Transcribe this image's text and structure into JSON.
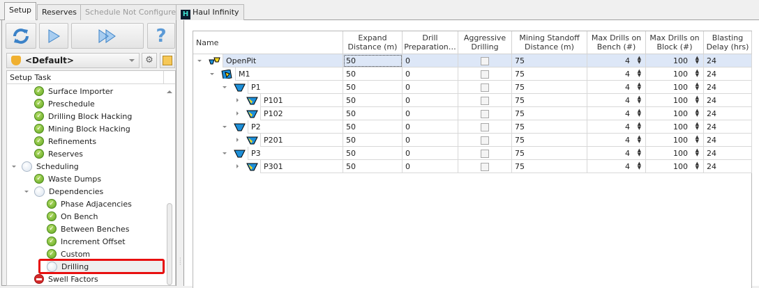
{
  "tabs": [
    {
      "label": "Setup",
      "state": "active"
    },
    {
      "label": "Reserves",
      "state": "normal"
    },
    {
      "label": "Schedule Not Configured",
      "state": "disabled"
    },
    {
      "label": "Haul Infinity",
      "state": "normal",
      "icon": "haul-infinity-icon"
    }
  ],
  "toolbar": {
    "buttons": [
      "refresh-icon",
      "play-icon",
      "fast-forward-icon",
      "help-icon"
    ],
    "help_glyph": "?"
  },
  "profile": {
    "selected": "<Default>",
    "gear_glyph": "⚙"
  },
  "setup_task": {
    "header": "Setup Task",
    "items": [
      {
        "label": "Surface Importer",
        "status": "ok",
        "level": 2
      },
      {
        "label": "Preschedule",
        "status": "ok",
        "level": 2
      },
      {
        "label": "Drilling Block Hacking",
        "status": "ok",
        "level": 2
      },
      {
        "label": "Mining Block Hacking",
        "status": "ok",
        "level": 2
      },
      {
        "label": "Refinements",
        "status": "ok",
        "level": 2
      },
      {
        "label": "Reserves",
        "status": "ok",
        "level": 2
      },
      {
        "label": "Scheduling",
        "status": "pending",
        "level": 1,
        "expanded": true
      },
      {
        "label": "Waste Dumps",
        "status": "ok",
        "level": 2
      },
      {
        "label": "Dependencies",
        "status": "pending",
        "level": 2,
        "expanded": true
      },
      {
        "label": "Phase Adjacencies",
        "status": "ok",
        "level": 3
      },
      {
        "label": "On Bench",
        "status": "ok",
        "level": 3
      },
      {
        "label": "Between Benches",
        "status": "ok",
        "level": 3
      },
      {
        "label": "Increment Offset",
        "status": "ok",
        "level": 3
      },
      {
        "label": "Custom",
        "status": "ok",
        "level": 3
      },
      {
        "label": "Drilling",
        "status": "pending",
        "level": 3,
        "selected": true
      },
      {
        "label": "Swell Factors",
        "status": "error",
        "level": 2
      }
    ]
  },
  "grid": {
    "columns": [
      "Name",
      "Expand Distance (m)",
      "Drill Preparation…",
      "Aggressive Drilling",
      "Mining Standoff Distance (m)",
      "Max Drills on Bench (#)",
      "Max Drills on Block (#)",
      "Blasting Delay (hrs)"
    ],
    "rows": [
      {
        "name": "OpenPit",
        "level": 0,
        "icon": "openpit-icon",
        "expander": "expanded",
        "expand": "50",
        "drill_prep": "0",
        "aggressive": false,
        "standoff": "75",
        "bench": "4",
        "block": "100",
        "delay": "24",
        "selected": true
      },
      {
        "name": "M1",
        "level": 1,
        "icon": "mine-icon",
        "expander": "expanded",
        "expand": "50",
        "drill_prep": "0",
        "aggressive": false,
        "standoff": "75",
        "bench": "4",
        "block": "100",
        "delay": "24"
      },
      {
        "name": "P1",
        "level": 2,
        "icon": "pit-icon",
        "expander": "expanded",
        "expand": "50",
        "drill_prep": "0",
        "aggressive": false,
        "standoff": "75",
        "bench": "4",
        "block": "100",
        "delay": "24"
      },
      {
        "name": "P101",
        "level": 3,
        "icon": "phase-icon",
        "expander": "collapsed",
        "expand": "50",
        "drill_prep": "0",
        "aggressive": false,
        "standoff": "75",
        "bench": "4",
        "block": "100",
        "delay": "24"
      },
      {
        "name": "P102",
        "level": 3,
        "icon": "phase-icon",
        "expander": "collapsed",
        "expand": "50",
        "drill_prep": "0",
        "aggressive": false,
        "standoff": "75",
        "bench": "4",
        "block": "100",
        "delay": "24"
      },
      {
        "name": "P2",
        "level": 2,
        "icon": "pit-icon",
        "expander": "expanded",
        "expand": "50",
        "drill_prep": "0",
        "aggressive": false,
        "standoff": "75",
        "bench": "4",
        "block": "100",
        "delay": "24"
      },
      {
        "name": "P201",
        "level": 3,
        "icon": "phase-icon",
        "expander": "collapsed",
        "expand": "50",
        "drill_prep": "0",
        "aggressive": false,
        "standoff": "75",
        "bench": "4",
        "block": "100",
        "delay": "24"
      },
      {
        "name": "P3",
        "level": 2,
        "icon": "pit-icon",
        "expander": "expanded",
        "expand": "50",
        "drill_prep": "0",
        "aggressive": false,
        "standoff": "75",
        "bench": "4",
        "block": "100",
        "delay": "24"
      },
      {
        "name": "P301",
        "level": 3,
        "icon": "phase-icon",
        "expander": "collapsed",
        "expand": "50",
        "drill_prep": "0",
        "aggressive": false,
        "standoff": "75",
        "bench": "4",
        "block": "100",
        "delay": "24"
      }
    ]
  },
  "colors": {
    "selection": "#dde7f7",
    "highlight": "#e81010",
    "ok": "#5fa520",
    "error": "#d42a2a"
  }
}
